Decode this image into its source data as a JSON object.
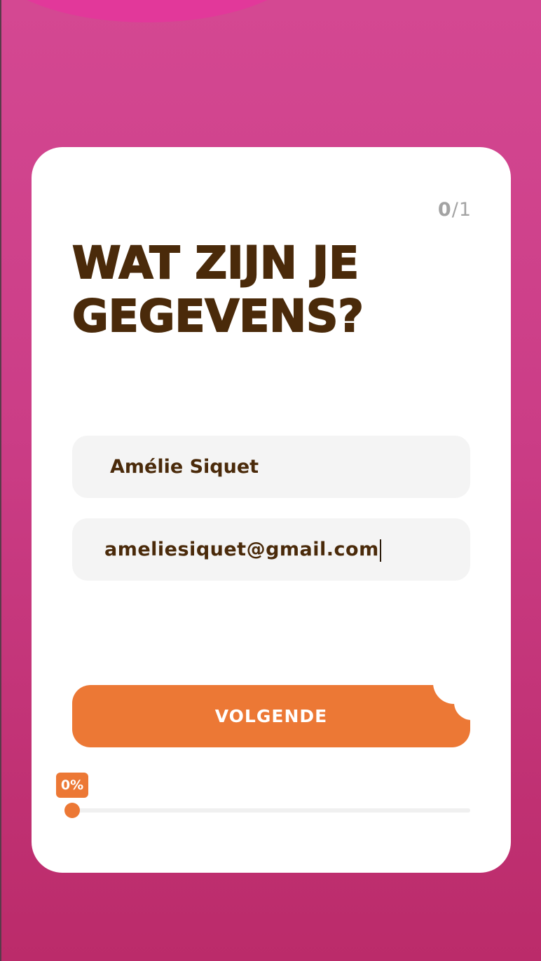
{
  "step": {
    "current": "0",
    "separator": "/",
    "total": "1"
  },
  "title": "WAT ZIJN JE GEGEVENS?",
  "form": {
    "name_value": "Amélie Siquet",
    "email_value": "ameliesiquet@gmail.com"
  },
  "next_button_label": "VOLGENDE",
  "progress": {
    "label": "0%",
    "value": 0
  },
  "colors": {
    "background_top": "#d44892",
    "background_bottom": "#bb2b6a",
    "accent": "#ec7835",
    "title_text": "#4a2a0a",
    "field_background": "#f4f4f4"
  }
}
